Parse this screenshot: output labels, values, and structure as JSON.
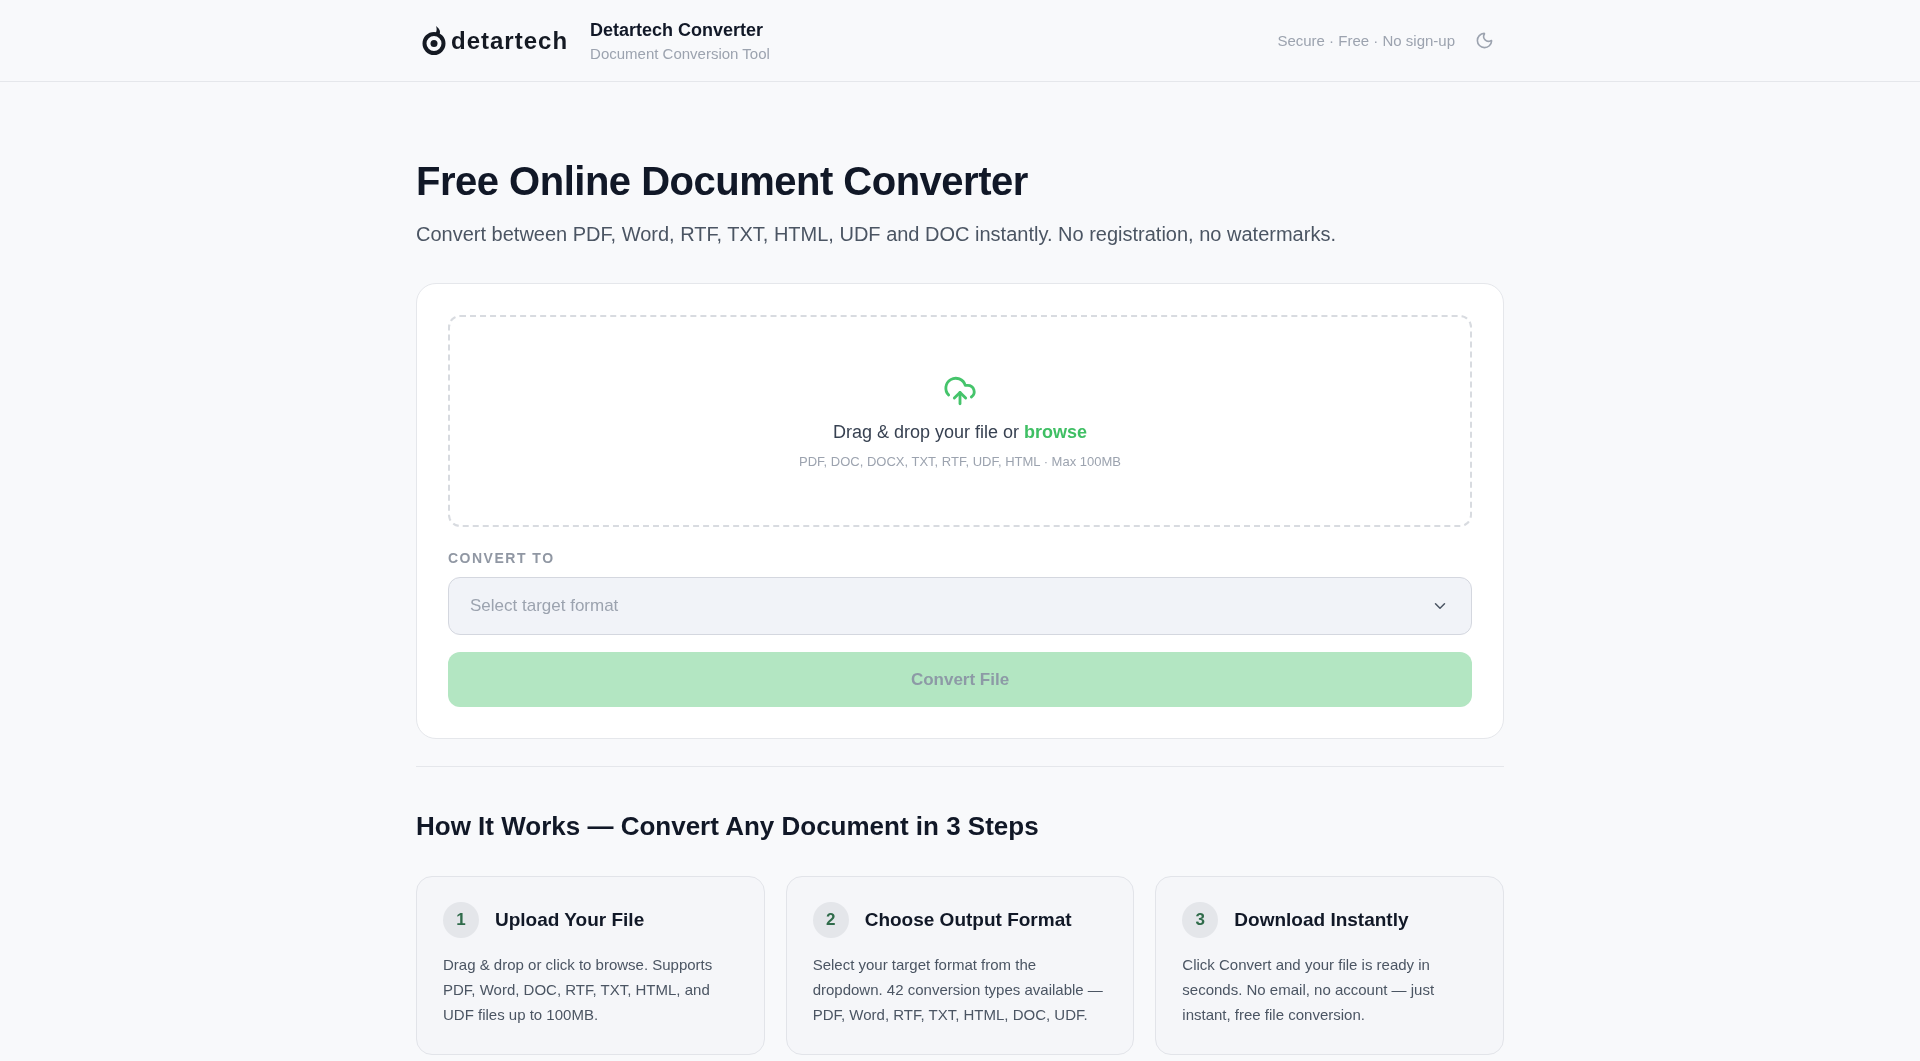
{
  "header": {
    "logo": "detartech",
    "title": "Detartech Converter",
    "subtitle": "Document Conversion Tool",
    "tagline": "Secure · Free · No sign-up"
  },
  "hero": {
    "title": "Free Online Document Converter",
    "subtitle": "Convert between PDF, Word, RTF, TXT, HTML, UDF and DOC instantly. No registration, no watermarks."
  },
  "converter": {
    "dropzone": {
      "prompt": "Drag & drop your file or",
      "link": "browse",
      "formats": "PDF, DOC, DOCX, TXT, RTF, UDF, HTML · Max 100MB"
    },
    "target_label": "CONVERT TO",
    "target_select": {
      "placeholder": "Select target format"
    },
    "convert_button": {
      "label": "Convert File",
      "disabled": true
    }
  },
  "how_it_works": {
    "title": "How It Works — Convert Any Document in 3 Steps",
    "steps": [
      {
        "number": "1",
        "title": "Upload Your File",
        "text": "Drag & drop or click to browse. Supports PDF, Word, DOC, RTF, TXT, HTML, and UDF files up to 100MB."
      },
      {
        "number": "2",
        "title": "Choose Output Format",
        "text": "Select your target format from the dropdown. 42 conversion types available — PDF, Word, RTF, TXT, HTML, DOC, UDF."
      },
      {
        "number": "3",
        "title": "Download Instantly",
        "text": "Click Convert and your file is ready in seconds. No email, no account — just instant, free file conversion."
      }
    ]
  }
}
